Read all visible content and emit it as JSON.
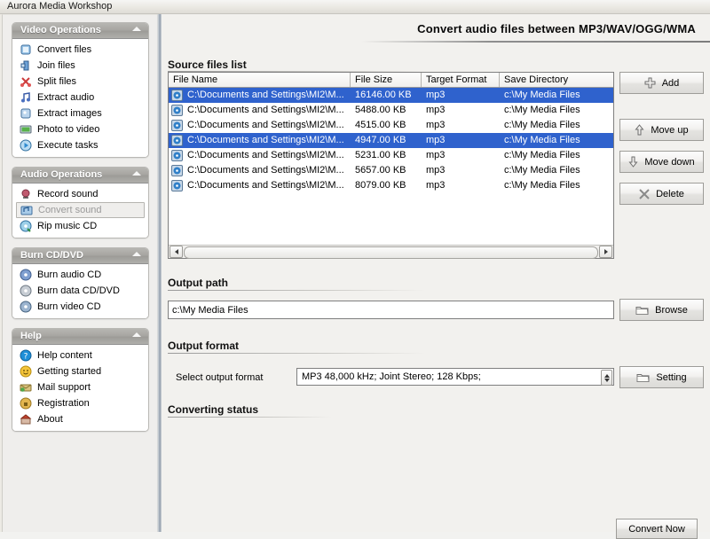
{
  "window": {
    "title": "Aurora Media Workshop"
  },
  "header": {
    "page_title": "Convert audio files between  MP3/WAV/OGG/WMA"
  },
  "sidebar": {
    "panels": [
      {
        "title": "Video Operations",
        "items": [
          {
            "label": "Convert files",
            "icon": "convert-files-icon"
          },
          {
            "label": "Join files",
            "icon": "join-files-icon"
          },
          {
            "label": "Split files",
            "icon": "split-files-icon"
          },
          {
            "label": "Extract audio",
            "icon": "extract-audio-icon"
          },
          {
            "label": "Extract images",
            "icon": "extract-images-icon"
          },
          {
            "label": "Photo to video",
            "icon": "photo-to-video-icon"
          },
          {
            "label": "Execute tasks",
            "icon": "execute-tasks-icon"
          }
        ]
      },
      {
        "title": "Audio Operations",
        "items": [
          {
            "label": "Record sound",
            "icon": "record-sound-icon"
          },
          {
            "label": "Convert sound",
            "icon": "convert-sound-icon",
            "selected": true
          },
          {
            "label": "Rip music CD",
            "icon": "rip-music-cd-icon"
          }
        ]
      },
      {
        "title": "Burn CD/DVD",
        "items": [
          {
            "label": "Burn audio CD",
            "icon": "burn-audio-cd-icon"
          },
          {
            "label": "Burn data CD/DVD",
            "icon": "burn-data-cd-icon"
          },
          {
            "label": "Burn video CD",
            "icon": "burn-video-cd-icon"
          }
        ]
      },
      {
        "title": "Help",
        "items": [
          {
            "label": "Help content",
            "icon": "help-content-icon"
          },
          {
            "label": "Getting started",
            "icon": "getting-started-icon"
          },
          {
            "label": "Mail support",
            "icon": "mail-support-icon"
          },
          {
            "label": "Registration",
            "icon": "registration-icon"
          },
          {
            "label": "About",
            "icon": "about-icon"
          }
        ]
      }
    ]
  },
  "source_files": {
    "section_title": "Source files list",
    "columns": [
      "File Name",
      "File Size",
      "Target Format",
      "Save Directory"
    ],
    "rows": [
      {
        "name": "C:\\Documents and Settings\\MI2\\M...",
        "size": "16146.00 KB",
        "format": "mp3",
        "dir": "c:\\My Media Files",
        "selected": true
      },
      {
        "name": "C:\\Documents and Settings\\MI2\\M...",
        "size": "5488.00 KB",
        "format": "mp3",
        "dir": "c:\\My Media Files",
        "selected": false
      },
      {
        "name": "C:\\Documents and Settings\\MI2\\M...",
        "size": "4515.00 KB",
        "format": "mp3",
        "dir": "c:\\My Media Files",
        "selected": false
      },
      {
        "name": "C:\\Documents and Settings\\MI2\\M...",
        "size": "4947.00 KB",
        "format": "mp3",
        "dir": "c:\\My Media Files",
        "selected": true
      },
      {
        "name": "C:\\Documents and Settings\\MI2\\M...",
        "size": "5231.00 KB",
        "format": "mp3",
        "dir": "c:\\My Media Files",
        "selected": false
      },
      {
        "name": "C:\\Documents and Settings\\MI2\\M...",
        "size": "5657.00 KB",
        "format": "mp3",
        "dir": "c:\\My Media Files",
        "selected": false
      },
      {
        "name": "C:\\Documents and Settings\\MI2\\M...",
        "size": "8079.00 KB",
        "format": "mp3",
        "dir": "c:\\My Media Files",
        "selected": false
      }
    ],
    "buttons": [
      {
        "label": "Add",
        "icon": "plus-icon"
      },
      {
        "label": "Move up",
        "icon": "arrow-up-icon"
      },
      {
        "label": "Move down",
        "icon": "arrow-down-icon"
      },
      {
        "label": "Delete",
        "icon": "close-x-icon"
      }
    ]
  },
  "output_path": {
    "section_title": "Output path",
    "value": "c:\\My Media Files",
    "browse_label": "Browse",
    "browse_icon": "folder-icon"
  },
  "output_format": {
    "section_title": "Output format",
    "field_label": "Select output format",
    "selected_option": "MP3 48,000 kHz; Joint Stereo;  128 Kbps;",
    "setting_label": "Setting",
    "setting_icon": "folder-icon"
  },
  "converting_status": {
    "section_title": "Converting status"
  },
  "actions": {
    "convert_now_label": "Convert Now"
  },
  "colors": {
    "selection_blue": "#2f62cd",
    "panel_header_gray": "#a6a5a1",
    "window_bg": "#f2f1ee"
  }
}
